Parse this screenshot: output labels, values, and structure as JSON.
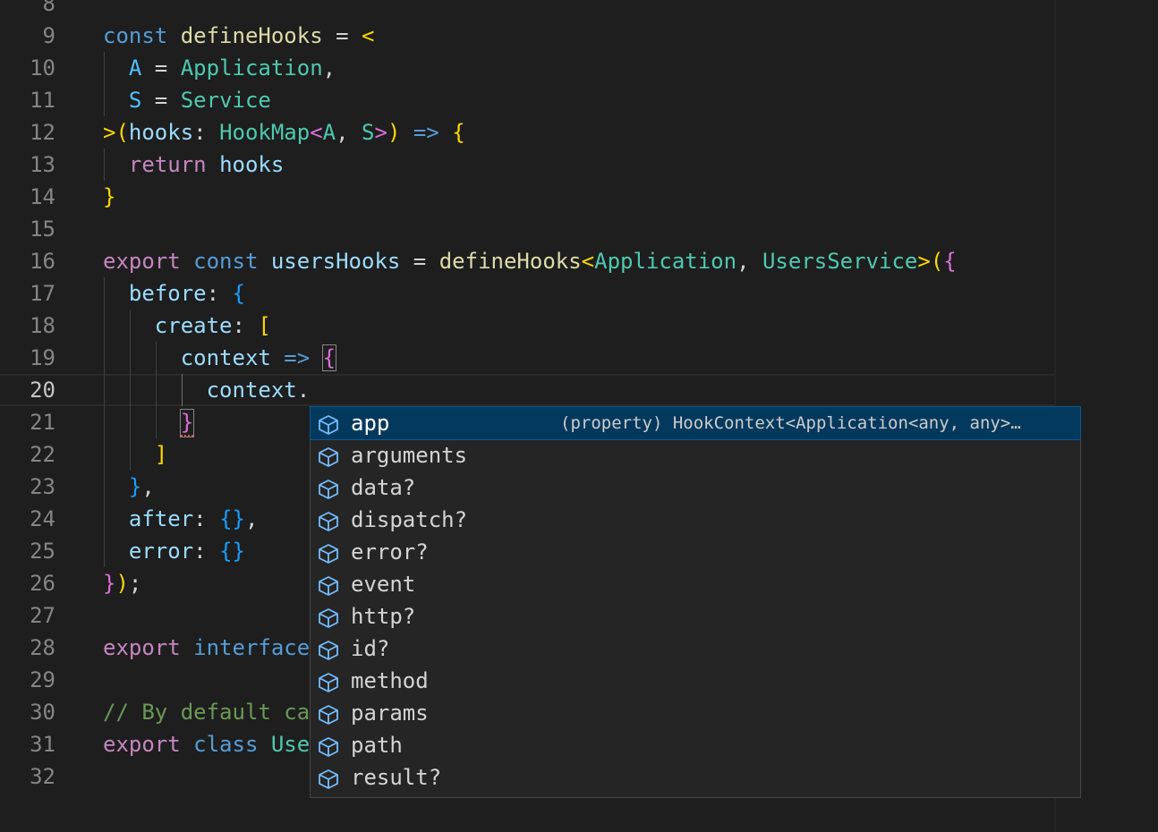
{
  "editor": {
    "lines": [
      {
        "n": "8",
        "tokens": []
      },
      {
        "n": "9",
        "tokens": [
          [
            "k",
            "const "
          ],
          [
            "f",
            "defineHooks"
          ],
          [
            "p",
            " = "
          ],
          [
            "b1",
            "<"
          ]
        ]
      },
      {
        "n": "10",
        "tokens": [
          [
            "p",
            "  "
          ],
          [
            "vc",
            "A"
          ],
          [
            "p",
            " = "
          ],
          [
            "t",
            "Application"
          ],
          [
            "p",
            ","
          ]
        ]
      },
      {
        "n": "11",
        "tokens": [
          [
            "p",
            "  "
          ],
          [
            "vc",
            "S"
          ],
          [
            "p",
            " = "
          ],
          [
            "t",
            "Service"
          ]
        ]
      },
      {
        "n": "12",
        "tokens": [
          [
            "b1",
            ">("
          ],
          [
            "v",
            "hooks"
          ],
          [
            "p",
            ": "
          ],
          [
            "t",
            "HookMap"
          ],
          [
            "b2",
            "<"
          ],
          [
            "t",
            "A"
          ],
          [
            "p",
            ", "
          ],
          [
            "t",
            "S"
          ],
          [
            "b2",
            ">"
          ],
          [
            "b1",
            ")"
          ],
          [
            "k",
            " => "
          ],
          [
            "b1",
            "{"
          ]
        ]
      },
      {
        "n": "13",
        "tokens": [
          [
            "p",
            "  "
          ],
          [
            "kc",
            "return "
          ],
          [
            "v",
            "hooks"
          ]
        ]
      },
      {
        "n": "14",
        "tokens": [
          [
            "b1",
            "}"
          ]
        ]
      },
      {
        "n": "15",
        "tokens": []
      },
      {
        "n": "16",
        "tokens": [
          [
            "kc",
            "export "
          ],
          [
            "k",
            "const "
          ],
          [
            "v",
            "usersHooks"
          ],
          [
            "p",
            " = "
          ],
          [
            "f",
            "defineHooks"
          ],
          [
            "b1",
            "<"
          ],
          [
            "t",
            "Application"
          ],
          [
            "p",
            ", "
          ],
          [
            "t",
            "UsersService"
          ],
          [
            "b1",
            ">("
          ],
          [
            "b2",
            "{"
          ]
        ]
      },
      {
        "n": "17",
        "tokens": [
          [
            "p",
            "  "
          ],
          [
            "v",
            "before"
          ],
          [
            "p",
            ": "
          ],
          [
            "b3",
            "{"
          ]
        ]
      },
      {
        "n": "18",
        "tokens": [
          [
            "p",
            "    "
          ],
          [
            "v",
            "create"
          ],
          [
            "p",
            ": "
          ],
          [
            "b1",
            "["
          ]
        ]
      },
      {
        "n": "19",
        "tokens": [
          [
            "p",
            "      "
          ],
          [
            "v",
            "context"
          ],
          [
            "k",
            " => "
          ],
          [
            "b2m",
            "{"
          ]
        ]
      },
      {
        "n": "20",
        "tokens": [
          [
            "p",
            "        "
          ],
          [
            "v",
            "context"
          ],
          [
            "p",
            "."
          ]
        ]
      },
      {
        "n": "21",
        "tokens": [
          [
            "p",
            "      "
          ],
          [
            "b2m",
            "}"
          ]
        ]
      },
      {
        "n": "22",
        "tokens": [
          [
            "p",
            "    "
          ],
          [
            "b1",
            "]"
          ]
        ]
      },
      {
        "n": "23",
        "tokens": [
          [
            "p",
            "  "
          ],
          [
            "b3",
            "}"
          ],
          [
            "p",
            ","
          ]
        ]
      },
      {
        "n": "24",
        "tokens": [
          [
            "p",
            "  "
          ],
          [
            "v",
            "after"
          ],
          [
            "p",
            ": "
          ],
          [
            "b3",
            "{}"
          ],
          [
            "p",
            ","
          ]
        ]
      },
      {
        "n": "25",
        "tokens": [
          [
            "p",
            "  "
          ],
          [
            "v",
            "error"
          ],
          [
            "p",
            ": "
          ],
          [
            "b3",
            "{}"
          ]
        ]
      },
      {
        "n": "26",
        "tokens": [
          [
            "b2",
            "}"
          ],
          [
            "b1",
            ")"
          ],
          [
            "p",
            ";"
          ]
        ]
      },
      {
        "n": "27",
        "tokens": []
      },
      {
        "n": "28",
        "tokens": [
          [
            "kc",
            "export "
          ],
          [
            "k",
            "interface "
          ]
        ]
      },
      {
        "n": "29",
        "tokens": []
      },
      {
        "n": "30",
        "tokens": [
          [
            "c",
            "// By default ca"
          ]
        ]
      },
      {
        "n": "31",
        "tokens": [
          [
            "kc",
            "export "
          ],
          [
            "k",
            "class "
          ],
          [
            "t",
            "Use"
          ]
        ]
      },
      {
        "n": "32",
        "tokens": []
      }
    ]
  },
  "suggest": {
    "icon": "cube-property-icon",
    "items": [
      {
        "label": "app",
        "detail": "(property) HookContext<Application<any, any>…"
      },
      {
        "label": "arguments",
        "detail": ""
      },
      {
        "label": "data?",
        "detail": ""
      },
      {
        "label": "dispatch?",
        "detail": ""
      },
      {
        "label": "error?",
        "detail": ""
      },
      {
        "label": "event",
        "detail": ""
      },
      {
        "label": "http?",
        "detail": ""
      },
      {
        "label": "id?",
        "detail": ""
      },
      {
        "label": "method",
        "detail": ""
      },
      {
        "label": "params",
        "detail": ""
      },
      {
        "label": "path",
        "detail": ""
      },
      {
        "label": "result?",
        "detail": ""
      }
    ]
  }
}
